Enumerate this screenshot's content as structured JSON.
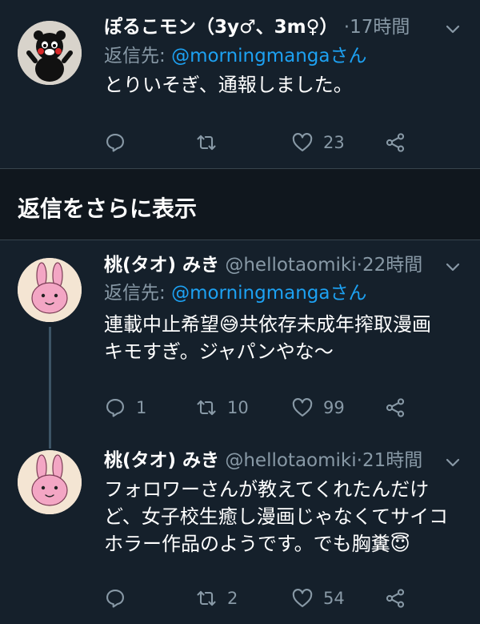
{
  "tweets": [
    {
      "name": "ぽるこモン（3y♂、3m♀）",
      "handle": "",
      "dot": "·",
      "time": "17時間",
      "reply_prefix": "返信先: ",
      "reply_mention": "@morningmangaさん",
      "body_lines": [
        "とりいそぎ、通報しました。"
      ],
      "reply_count": "",
      "retweet_count": "",
      "like_count": "23"
    },
    {
      "name": "桃(タオ) みき",
      "handle": "@hellotaomiki",
      "dot": "·",
      "time": "22時間",
      "reply_prefix": "返信先: ",
      "reply_mention": "@morningmangaさん",
      "body_lines": [
        "連載中止希望😅共依存未成年搾取漫画",
        "キモすぎ。ジャパンやな〜"
      ],
      "reply_count": "1",
      "retweet_count": "10",
      "like_count": "99"
    },
    {
      "name": "桃(タオ) みき",
      "handle": "@hellotaomiki",
      "dot": "·",
      "time": "21時間",
      "body_lines": [
        "フォロワーさんが教えてくれたんだけ",
        "ど、女子校生癒し漫画じゃなくてサイコ",
        "ホラー作品のようです。でも胸糞😇"
      ],
      "reply_count": "",
      "retweet_count": "2",
      "like_count": "54"
    }
  ],
  "show_more_label": "返信をさらに表示",
  "icons": [
    "caret-down-icon",
    "reply-icon",
    "retweet-icon",
    "like-icon",
    "share-icon"
  ],
  "colors": {
    "background": "#15202b",
    "muted": "#8899a6",
    "link": "#1da1f2",
    "divider": "#38444d"
  }
}
